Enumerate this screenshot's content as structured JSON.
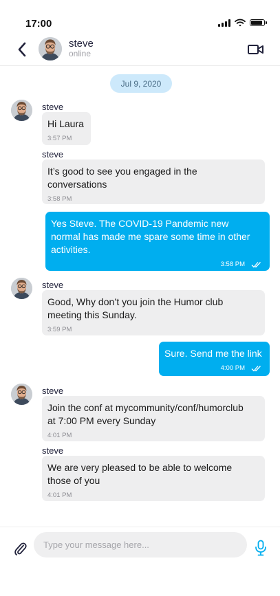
{
  "status_bar": {
    "time": "17:00"
  },
  "contact": {
    "name": "steve",
    "status": "online"
  },
  "conversation": {
    "date": "Jul 9, 2020",
    "messages": [
      {
        "sender": "steve",
        "text": "Hi Laura",
        "time": "3:57 PM"
      },
      {
        "sender": "steve",
        "text": "It’s good to see you engaged in the\nconversations",
        "time": "3:58 PM"
      },
      {
        "sender": "me",
        "text": "Yes Steve. The COVID-19 Pandemic new\nnormal has made me spare some time in other\nactivities.",
        "time": "3:58 PM",
        "read": true
      },
      {
        "sender": "steve",
        "text": "Good, Why don’t you join the Humor club\nmeeting this Sunday.",
        "time": "3:59 PM"
      },
      {
        "sender": "me",
        "text": "Sure. Send me the link",
        "time": "4:00 PM",
        "read": true
      },
      {
        "sender": "steve",
        "text": "Join the conf at mycommunity/conf/humorclub\nat 7:00 PM every Sunday",
        "time": "4:01 PM"
      },
      {
        "sender": "steve",
        "text": "We are very pleased to be able to welcome\nthose of you",
        "time": "4:01 PM"
      }
    ]
  },
  "composer": {
    "placeholder": "Type your message here..."
  },
  "icons": {
    "back": "chevron-left-icon",
    "video": "video-camera-icon",
    "attach": "paperclip-icon",
    "mic": "microphone-icon",
    "read_receipt": "double-check-icon"
  },
  "colors": {
    "accent": "#00aeef",
    "incoming_bubble": "#eeeeef",
    "date_pill": "#cde9fb",
    "header_text": "#22233c"
  }
}
